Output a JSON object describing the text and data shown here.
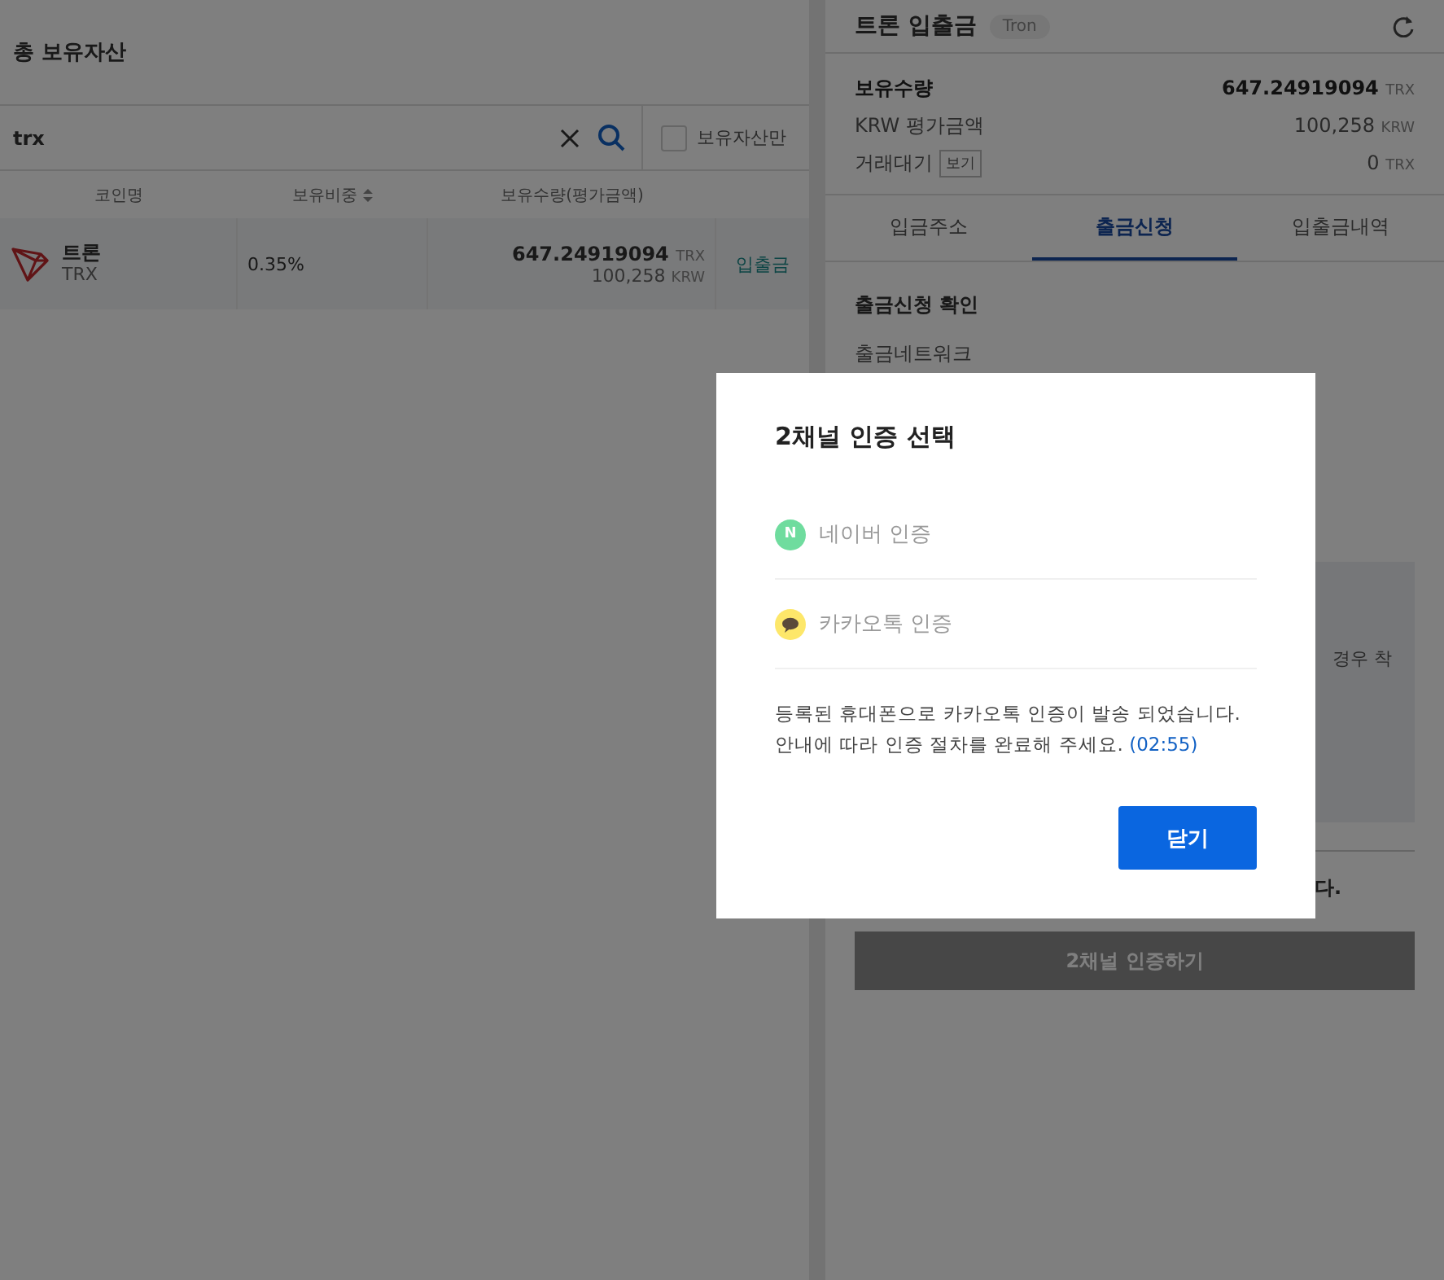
{
  "holdings": {
    "title": "총 보유자산",
    "search": {
      "value": "trx"
    },
    "filter": {
      "label": "보유자산만",
      "checked": false
    },
    "columns": [
      {
        "label": "코인명",
        "sortable": false
      },
      {
        "label": "보유비중",
        "sortable": true
      },
      {
        "label": "보유수량(평가금액)",
        "sortable": false
      }
    ],
    "rows": [
      {
        "name": "트론",
        "symbol": "TRX",
        "share": "0.35%",
        "amount": "647.24919094",
        "amount_unit": "TRX",
        "value": "100,258",
        "value_unit": "KRW",
        "action": "입출금"
      }
    ]
  },
  "transfer": {
    "title": "트론 입출금",
    "badge": "Tron",
    "summary": [
      {
        "label": "보유수량",
        "value": "647.24919094",
        "unit": "TRX",
        "emphasis": true
      },
      {
        "label": "KRW 평가금액",
        "value": "100,258",
        "unit": "KRW",
        "emphasis": false
      },
      {
        "label": "거래대기",
        "button": "보기",
        "value": "0",
        "unit": "TRX",
        "emphasis": false
      }
    ],
    "tabs": [
      {
        "label": "입금주소",
        "selected": false
      },
      {
        "label": "출금신청",
        "selected": true
      },
      {
        "label": "입출금내역",
        "selected": false
      }
    ],
    "section_title": "출금신청 확인",
    "network_label": "출금네트워크",
    "notice_fragment": "경우 착",
    "confirm_fragment": "다.",
    "submit": {
      "label": "2채널 인증하기",
      "disabled": true
    }
  },
  "dialog": {
    "title": "2채널 인증 선택",
    "options": [
      {
        "kind": "naver",
        "label": "네이버 인증",
        "icon_text": "N"
      },
      {
        "kind": "kakao",
        "label": "카카오톡 인증"
      }
    ],
    "message": [
      "등록된 휴대폰으로 카카오톡 인증이 발송 되었습니다.",
      "안내에 따라 인증 절차를 완료해 주세요."
    ],
    "timer": "(02:55)",
    "close": "닫기"
  }
}
